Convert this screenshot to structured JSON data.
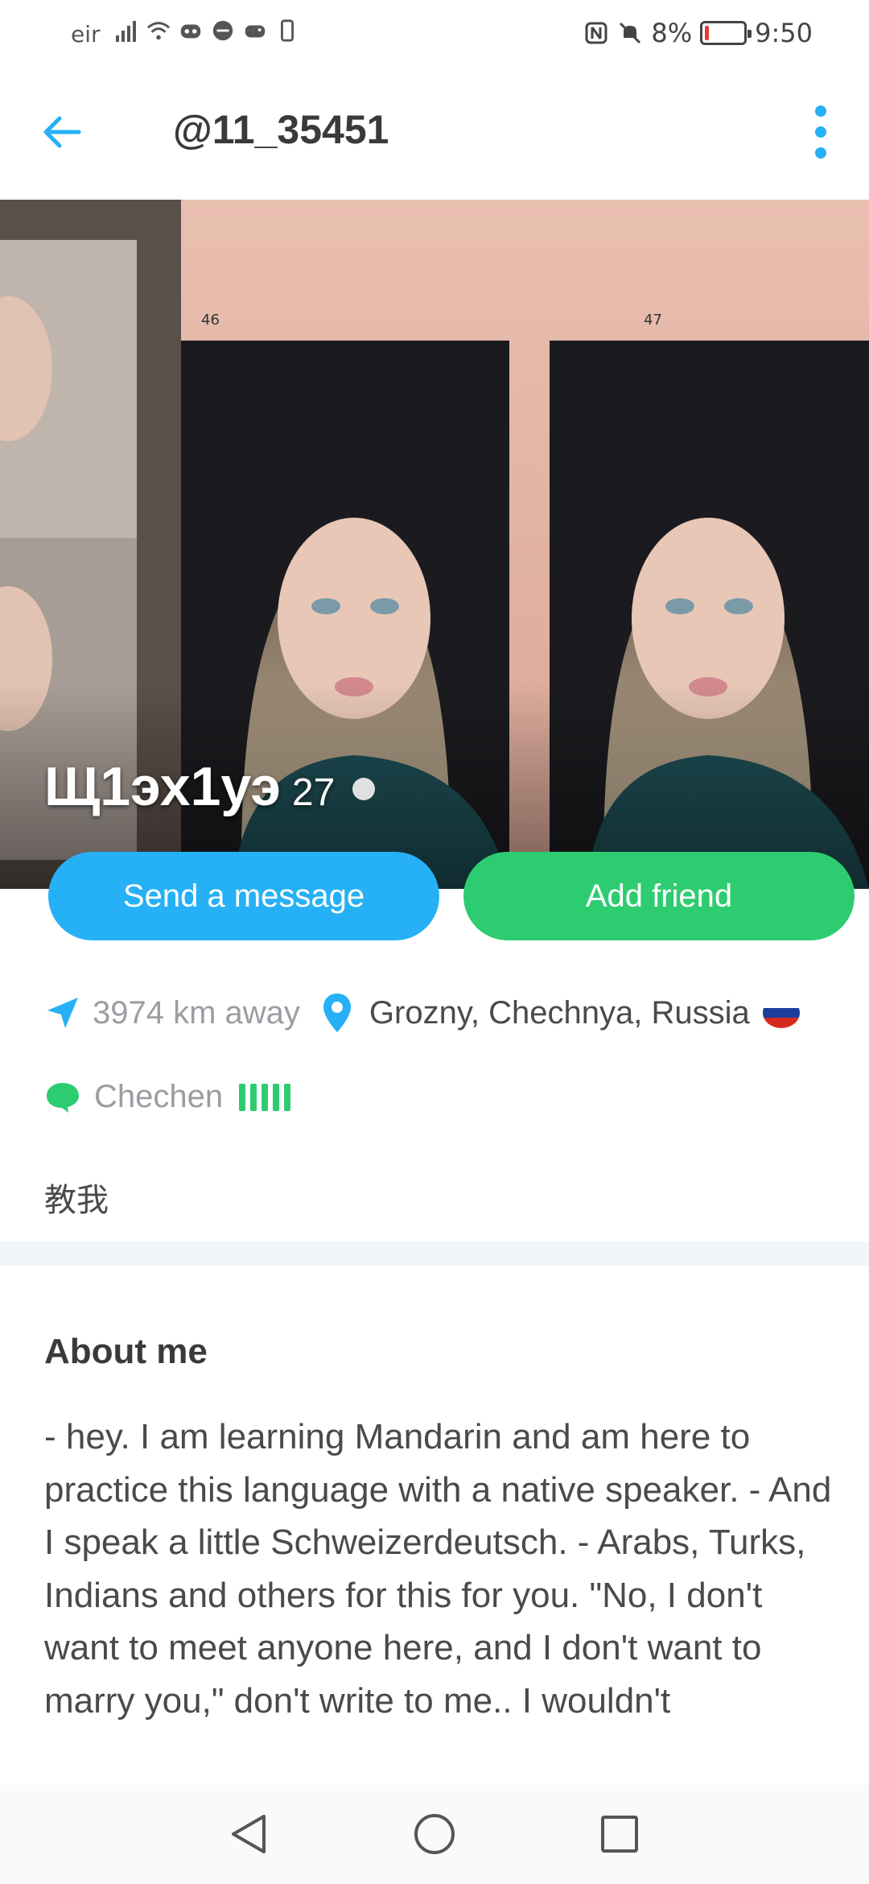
{
  "status_bar": {
    "carrier": "eir",
    "battery": "8%",
    "time": "9:50"
  },
  "header": {
    "title": "@11_35451"
  },
  "profile": {
    "name": "Щ1эх1уэ",
    "age": "27"
  },
  "actions": {
    "message_label": "Send a message",
    "add_friend_label": "Add friend"
  },
  "location": {
    "distance": "3974 km away",
    "city": "Grozny, Chechnya, Russia"
  },
  "language": {
    "name": "Chechen"
  },
  "learning": "教我",
  "about": {
    "title": "About me",
    "text": "- hey. I am learning Mandarin and am here to practice this language with a native speaker. - And I speak a little Schweizerdeutsch. - Arabs, Turks, Indians and others for this for you. \"No, I don't want to meet anyone here, and I don't want to marry you,\" don't write to me.. I wouldn't"
  },
  "colors": {
    "accent_blue": "#26b0f5",
    "accent_green": "#2ecc71"
  }
}
